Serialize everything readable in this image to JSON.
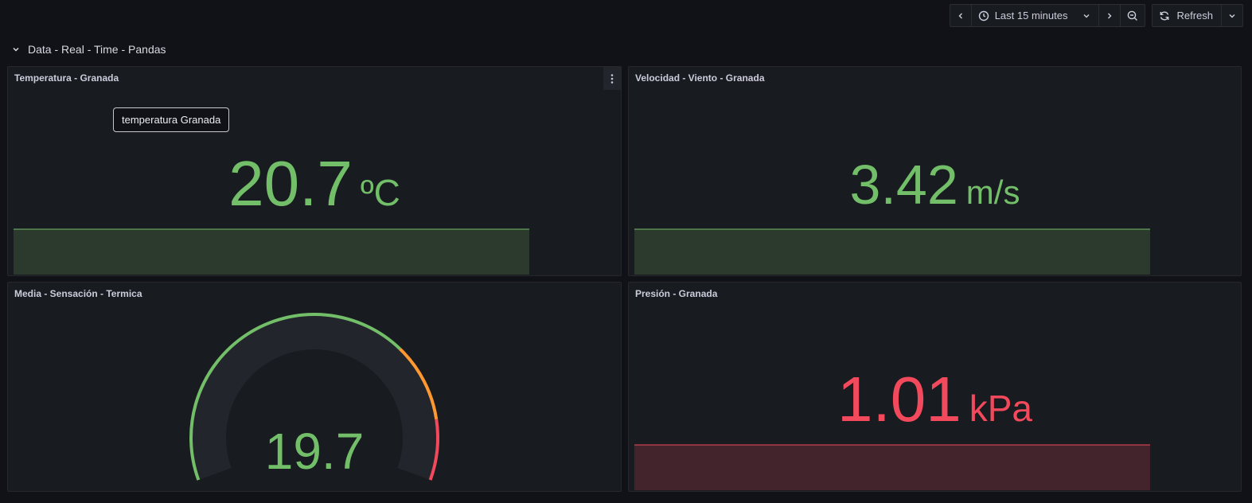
{
  "toolbar": {
    "time_range_label": "Last 15 minutes",
    "refresh_label": "Refresh",
    "icons": [
      "chevron-left-icon",
      "clock-icon",
      "chevron-down-icon",
      "chevron-right-icon",
      "zoom-out-icon",
      "refresh-icon",
      "chevron-down-icon"
    ]
  },
  "row": {
    "title": "Data - Real - Time - Pandas",
    "icon": "chevron-down-icon"
  },
  "panels": {
    "temperatura": {
      "title": "Temperatura - Granada",
      "value": "20.7",
      "unit": "ºC",
      "tooltip": "temperatura Granada",
      "color": "#73bf69",
      "spark_fill": "#2c3a2e"
    },
    "velocidad": {
      "title": "Velocidad - Viento - Granada",
      "value": "3.42",
      "unit": "m/s",
      "color": "#73bf69",
      "spark_fill": "#2c3a2e"
    },
    "sensacion": {
      "title": "Media - Sensación - Termica",
      "value": "19.7",
      "gauge_fraction_green": 0.7,
      "gauge_fraction_orange": 0.17,
      "gauge_fraction_red": 0.13,
      "colors": {
        "green": "#73bf69",
        "orange": "#ff9830",
        "red": "#f2495c",
        "track": "#22252b"
      }
    },
    "presion": {
      "title": "Presión - Granada",
      "value": "1.01",
      "unit": "kPa",
      "color": "#f2495c",
      "spark_fill": "#44242c"
    }
  }
}
